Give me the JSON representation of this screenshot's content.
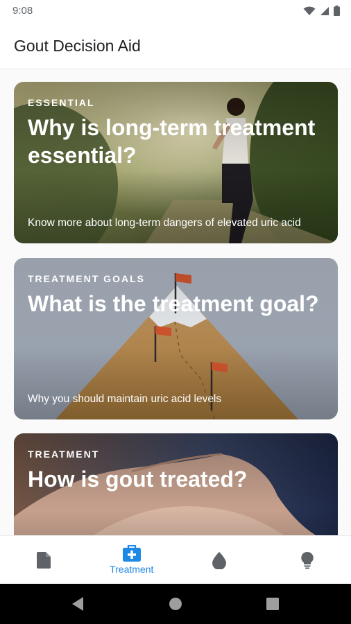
{
  "status_bar": {
    "time": "9:08",
    "icons": [
      "wifi-icon",
      "signal-icon",
      "battery-icon"
    ]
  },
  "app_bar": {
    "title": "Gout Decision Aid"
  },
  "cards": [
    {
      "eyebrow": "ESSENTIAL",
      "title": "Why is long-term treatment essential?",
      "subtitle": "Know more about long-term dangers of elevated uric acid"
    },
    {
      "eyebrow": "TREATMENT GOALS",
      "title": "What is the treatment goal?",
      "subtitle": "Why you should maintain uric acid levels"
    },
    {
      "eyebrow": "TREATMENT",
      "title": "How is gout treated?",
      "subtitle": ""
    }
  ],
  "bottom_nav": {
    "items": [
      {
        "icon": "document-icon",
        "label": ""
      },
      {
        "icon": "medical-kit-icon",
        "label": "Treatment",
        "active": true
      },
      {
        "icon": "drop-icon",
        "label": ""
      },
      {
        "icon": "lightbulb-icon",
        "label": ""
      }
    ]
  },
  "colors": {
    "accent": "#1e88e5",
    "inactive_icon": "#5f6368"
  }
}
